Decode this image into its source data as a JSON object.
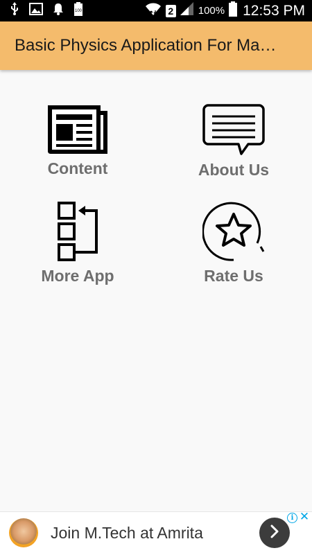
{
  "status_bar": {
    "battery_percent": "100%",
    "time": "12:53 PM",
    "sim_number": "2",
    "icons": [
      "usb-icon",
      "image-icon",
      "notification-bell-icon",
      "battery-saver-icon",
      "wifi-icon",
      "signal-icon",
      "battery-icon"
    ]
  },
  "app_bar": {
    "title": "Basic Physics Application For Ma…",
    "background_color": "#f4bb6c"
  },
  "menu": {
    "items": [
      {
        "label": "Content",
        "icon": "newspaper-icon"
      },
      {
        "label": "About Us",
        "icon": "chat-bubble-icon"
      },
      {
        "label": "More App",
        "icon": "apps-list-icon"
      },
      {
        "label": "Rate Us",
        "icon": "star-icon"
      }
    ],
    "label_color": "#6e6e6e"
  },
  "ad": {
    "text": "Join M.Tech at Amrita",
    "info_symbol": "i",
    "close_symbol": "✕",
    "accent_color": "#00a6e6"
  }
}
